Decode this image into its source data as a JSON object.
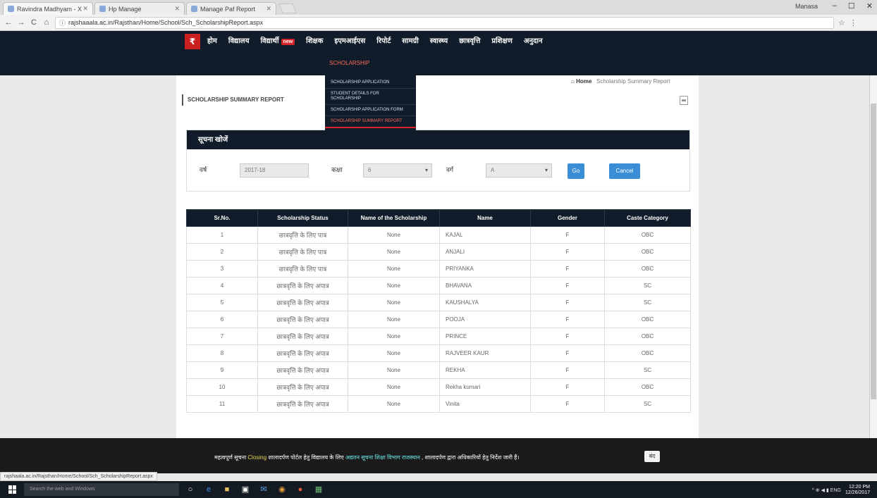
{
  "browser": {
    "tabs": [
      {
        "label": "Ravindra Madhyam - X"
      },
      {
        "label": "Hp Manage"
      },
      {
        "label": "Manage Paf Report"
      }
    ],
    "user": "Manasa",
    "controls": {
      "min": "–",
      "max": "☐",
      "close": "✕"
    },
    "nav": {
      "back": "←",
      "forward": "→",
      "reload": "C",
      "home": "⌂"
    },
    "url": "rajshaaala.ac.in/Rajsthan/Home/School/Sch_ScholarshipReport.aspx"
  },
  "site_nav": {
    "logo": "₹",
    "items": [
      "होम",
      "विद्यालय",
      "विद्यार्थी",
      "शिक्षक",
      "इएमआईएस",
      "रिपोर्ट",
      "सामग्री",
      "स्वास्थ्य",
      "छात्रवृत्ति",
      "प्रशिक्षण",
      "अनुदान"
    ],
    "new_badge": "new",
    "current_section": "SCHOLARSHIP"
  },
  "dropdown": {
    "items": [
      "SCHOLARSHIP APPLICATION",
      "STUDENT DETAILS FOR SCHOLARSHIP",
      "SCHOLARSHIP APPLICATION FORM",
      "SCHOLARSHIP SUMMARY REPORT"
    ]
  },
  "breadcrumb": {
    "home": "Home",
    "current": "Scholarship Summary Report"
  },
  "report_title": "SCHOLARSHIP SUMMARY REPORT",
  "filter": {
    "header": "सूचना खोजें",
    "year_label": "वर्ष",
    "year_value": "2017-18",
    "class_label": "कक्षा",
    "class_value": "6",
    "section_label": "वर्ग",
    "section_value": "A",
    "go_label": "Go",
    "cancel_label": "Cancel"
  },
  "table": {
    "headers": [
      "Sr.No.",
      "Scholarship Status",
      "Name of the Scholarship",
      "Name",
      "Gender",
      "Caste Category"
    ],
    "rows": [
      [
        "1",
        "छात्रवृत्ति के लिए पात्र",
        "None",
        "KAJAL",
        "F",
        "OBC"
      ],
      [
        "2",
        "छात्रवृत्ति के लिए पात्र",
        "None",
        "ANJALI",
        "F",
        "OBC"
      ],
      [
        "3",
        "छात्रवृत्ति के लिए पात्र",
        "None",
        "PRIYANKA",
        "F",
        "OBC"
      ],
      [
        "4",
        "छात्रवृत्ति के लिए अपात्र",
        "None",
        "BHAVANA",
        "F",
        "SC"
      ],
      [
        "5",
        "छात्रवृत्ति के लिए अपात्र",
        "None",
        "KAUSHALYA",
        "F",
        "SC"
      ],
      [
        "6",
        "छात्रवृत्ति के लिए अपात्र",
        "None",
        "POOJA",
        "F",
        "OBC"
      ],
      [
        "7",
        "छात्रवृत्ति के लिए अपात्र",
        "None",
        "PRINCE",
        "F",
        "OBC"
      ],
      [
        "8",
        "छात्रवृत्ति के लिए अपात्र",
        "None",
        "RAJVEER KAUR",
        "F",
        "OBC"
      ],
      [
        "9",
        "छात्रवृत्ति के लिए अपात्र",
        "None",
        "REKHA",
        "F",
        "SC"
      ],
      [
        "10",
        "छात्रवृत्ति के लिए अपात्र",
        "None",
        "Rekha kumari",
        "F",
        "OBC"
      ],
      [
        "11",
        "छात्रवृत्ति के लिए अपात्र",
        "None",
        "Vinita",
        "F",
        "SC"
      ]
    ]
  },
  "ticker": {
    "part1": "महत्वपूर्ण सूचना",
    "part2": "Closing",
    "part3": " शालादर्पण पोर्टल हेतु विद्यालय के लिए ",
    "part4": "अद्यतन सूचना शिक्षा विभाग राजस्थान",
    "part5": ", शालादर्पण द्वारा अधिकारियों हेतु निर्देश जारी हैं।",
    "button": "बंद"
  },
  "status_url": "rajshaala.ac.in/Rajsthan/Home/School/Sch_ScholarshipReport.aspx",
  "taskbar": {
    "search_placeholder": "Search the web and Windows",
    "tray": "^ ⊕ ◀ ▮ ENG",
    "time": "12:20 PM",
    "date": "12/26/2017"
  }
}
